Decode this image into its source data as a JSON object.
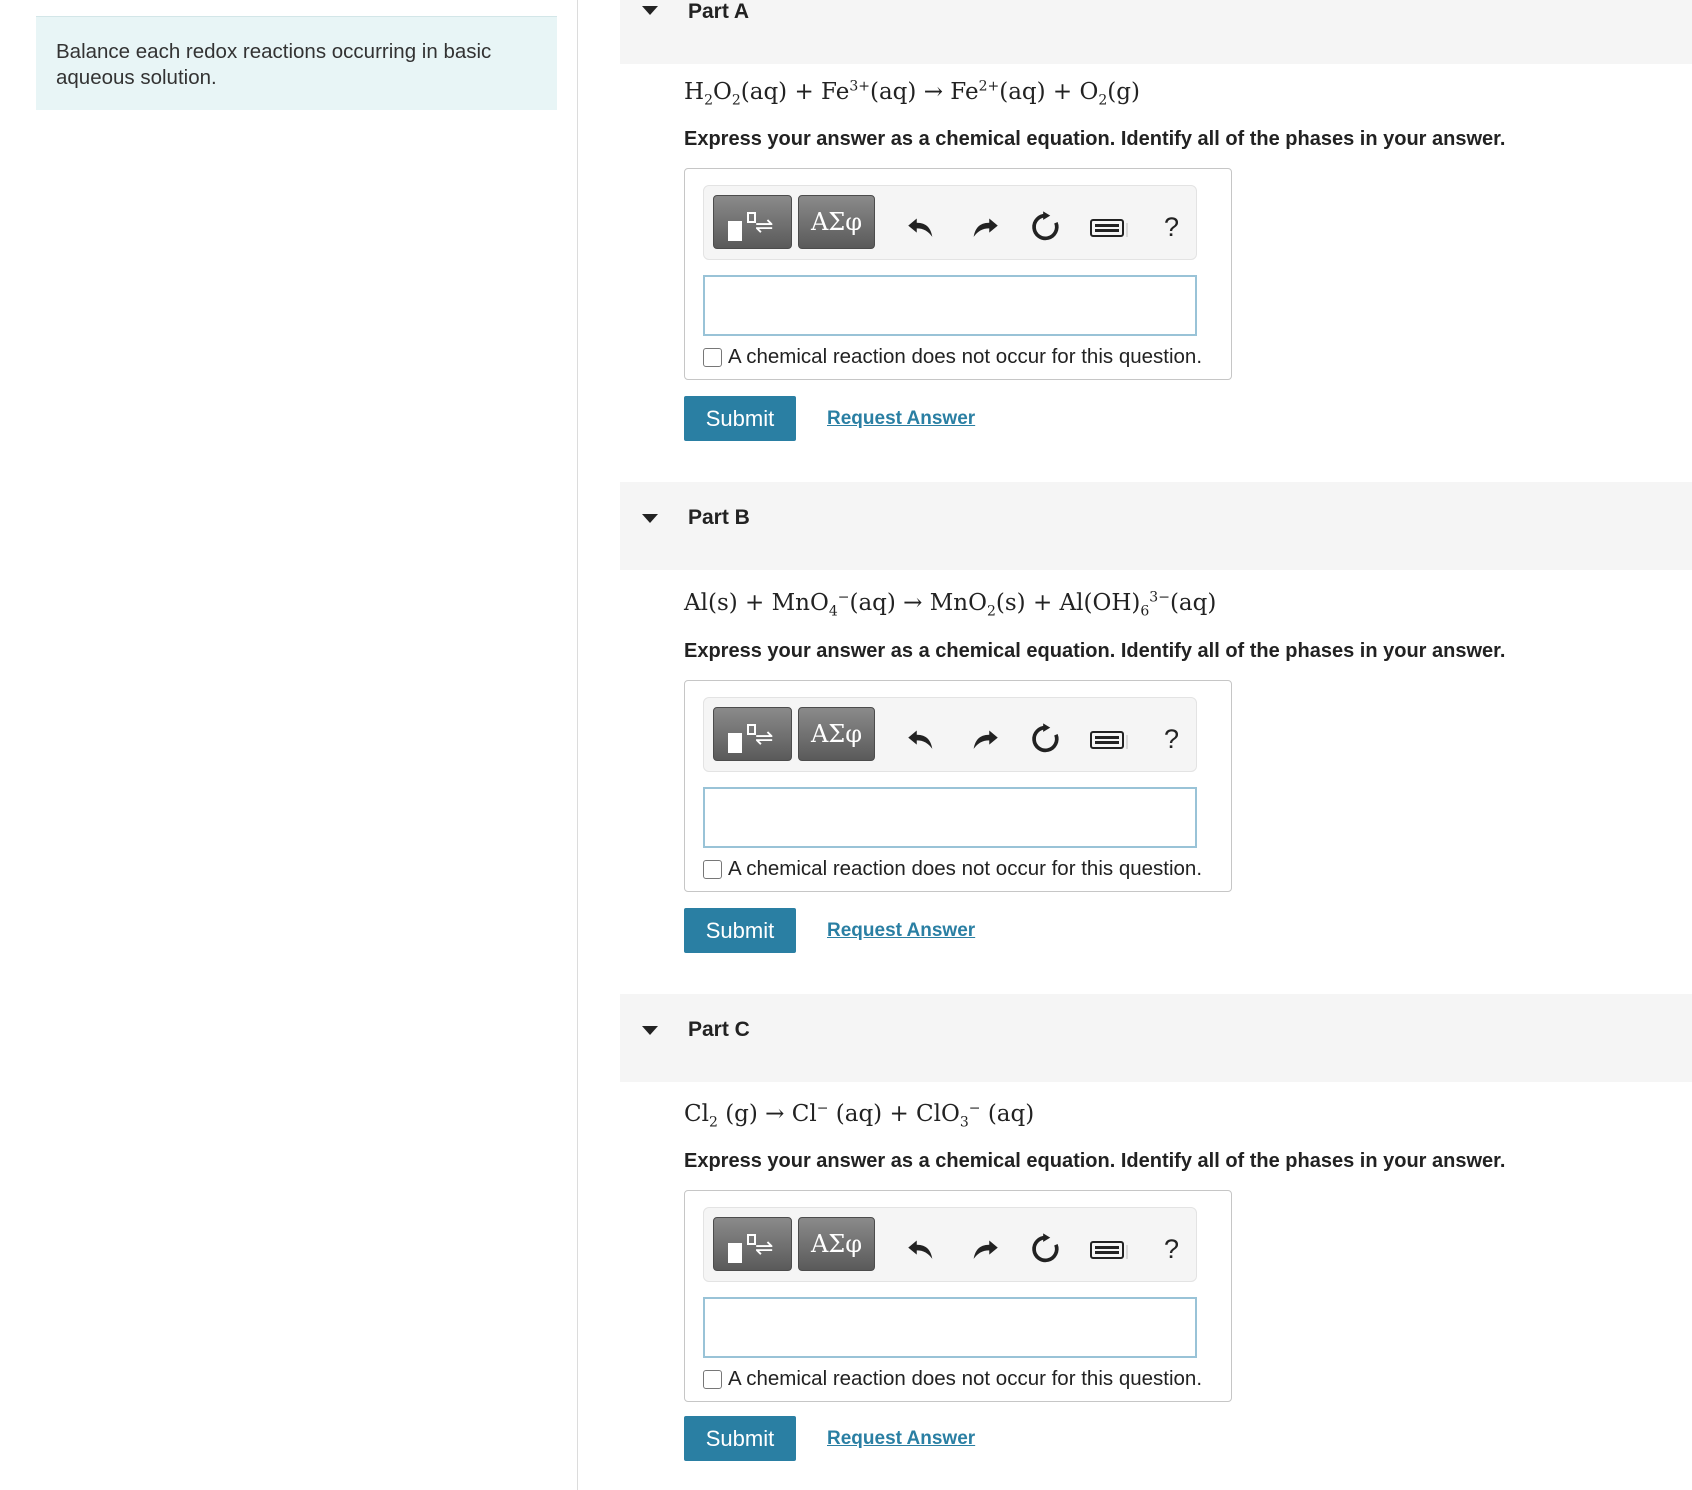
{
  "intro_text": "Balance each redox reactions occurring in basic aqueous solution.",
  "toolbar": {
    "greek_label": "ΑΣφ",
    "help_label": "?"
  },
  "instruction": "Express your answer as a chemical equation. Identify all of the phases in your answer.",
  "no_reaction_label": "A chemical reaction does not occur for this question.",
  "submit_label": "Submit",
  "request_answer_label": "Request Answer",
  "parts": [
    {
      "title": "Part A",
      "equation": "H2O2(aq) + Fe3+(aq) → Fe2+(aq) + O2(g)",
      "answer": ""
    },
    {
      "title": "Part B",
      "equation": "Al(s) + MnO4−(aq) → MnO2(s) + Al(OH)63−(aq)",
      "answer": ""
    },
    {
      "title": "Part C",
      "equation": "Cl2 (g) → Cl− (aq) + ClO3− (aq)",
      "answer": ""
    }
  ]
}
